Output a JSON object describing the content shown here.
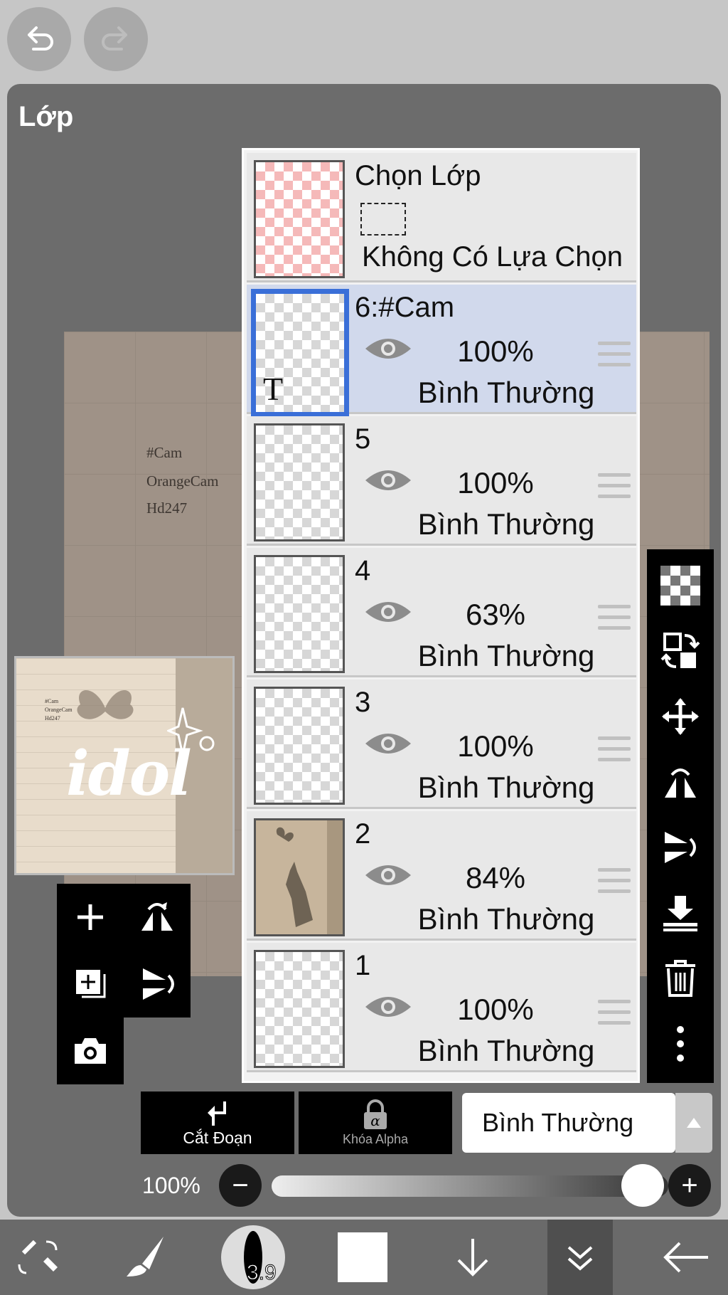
{
  "panel": {
    "title": "Lớp"
  },
  "canvas": {
    "lines": [
      "#Cam",
      "OrangeCam",
      "Hd247"
    ],
    "thumb_text": "idol"
  },
  "selection_layer": {
    "title": "Chọn Lớp",
    "status": "Không Có Lựa Chọn"
  },
  "layers": [
    {
      "name": "6:#Cam",
      "opacity": "100%",
      "blend": "Bình Thường",
      "selected": true,
      "thumb_glyph": "T"
    },
    {
      "name": "5",
      "opacity": "100%",
      "blend": "Bình Thường",
      "selected": false
    },
    {
      "name": "4",
      "opacity": "63%",
      "blend": "Bình Thường",
      "selected": false
    },
    {
      "name": "3",
      "opacity": "100%",
      "blend": "Bình Thường",
      "selected": false
    },
    {
      "name": "2",
      "opacity": "84%",
      "blend": "Bình Thường",
      "selected": false
    },
    {
      "name": "1",
      "opacity": "100%",
      "blend": "Bình Thường",
      "selected": false
    }
  ],
  "controls": {
    "clip_label": "Cắt Đoạn",
    "alpha_lock_label": "Khóa Alpha",
    "blend_mode": "Bình Thường",
    "opacity_label": "100%",
    "opacity_value": 1.0
  },
  "bottom_bar": {
    "brush_size": "3.9"
  },
  "colors": {
    "accent": "#3a6fd8",
    "panel": "#6c6c6c",
    "selected_row": "#d1d9ec"
  }
}
